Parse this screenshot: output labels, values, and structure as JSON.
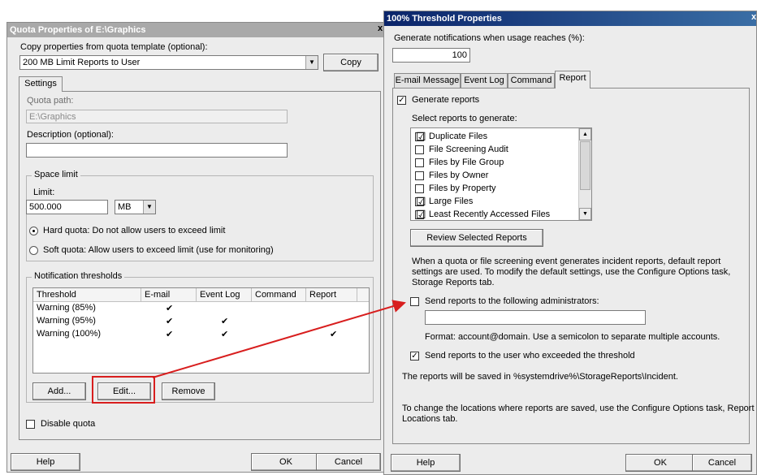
{
  "left_dialog": {
    "title": "Quota Properties of E:\\Graphics",
    "copy_label": "Copy properties from quota template (optional):",
    "template_value": "200 MB Limit Reports to User",
    "copy_button": "Copy",
    "settings_tab": "Settings",
    "quota_path_label": "Quota path:",
    "quota_path_value": "E:\\Graphics",
    "description_label": "Description (optional):",
    "description_value": "",
    "space_limit_title": "Space limit",
    "limit_label": "Limit:",
    "limit_value": "500.000",
    "limit_unit": "MB",
    "hard_quota_label": "Hard quota: Do not allow users to exceed limit",
    "soft_quota_label": "Soft quota: Allow users to exceed limit (use for monitoring)",
    "notification_title": "Notification thresholds",
    "table_headers": [
      "Threshold",
      "E-mail",
      "Event Log",
      "Command",
      "Report"
    ],
    "table_rows": [
      {
        "threshold": "Warning (85%)",
        "email": "✔",
        "eventlog": "",
        "command": "",
        "report": ""
      },
      {
        "threshold": "Warning (95%)",
        "email": "✔",
        "eventlog": "✔",
        "command": "",
        "report": ""
      },
      {
        "threshold": "Warning (100%)",
        "email": "✔",
        "eventlog": "✔",
        "command": "",
        "report": "✔"
      }
    ],
    "add_button": "Add...",
    "edit_button": "Edit...",
    "remove_button": "Remove",
    "disable_quota_label": "Disable quota",
    "help_button": "Help",
    "ok_button": "OK",
    "cancel_button": "Cancel"
  },
  "right_dialog": {
    "title": "100% Threshold Properties",
    "notify_label": "Generate notifications when usage reaches (%):",
    "notify_value": "100",
    "tabs": [
      "E-mail Message",
      "Event Log",
      "Command",
      "Report"
    ],
    "generate_reports_label": "Generate reports",
    "select_reports_label": "Select reports to generate:",
    "reports": [
      {
        "label": "Duplicate Files",
        "checked": "☑"
      },
      {
        "label": "File Screening Audit",
        "checked": ""
      },
      {
        "label": "Files by File Group",
        "checked": ""
      },
      {
        "label": "Files by Owner",
        "checked": ""
      },
      {
        "label": "Files by Property",
        "checked": ""
      },
      {
        "label": "Large Files",
        "checked": "☑"
      },
      {
        "label": "Least Recently Accessed Files",
        "checked": "☑"
      }
    ],
    "review_button": "Review Selected Reports",
    "info_text_1": "When a quota or file screening event generates incident reports, default report",
    "info_text_2": "settings are used. To modify the default settings, use the Configure Options task,",
    "info_text_3": "Storage Reports tab.",
    "send_admins_label": "Send reports to the following administrators:",
    "admins_value": "",
    "format_label": "Format: account@domain. Use a semicolon to separate multiple accounts.",
    "send_user_label": "Send reports to the user who exceeded the threshold",
    "saved_text": "The reports will be saved in %systemdrive%\\StorageReports\\Incident.",
    "change_text_1": "To change the locations where reports are saved, use the Configure Options task, Report",
    "change_text_2": "Locations tab.",
    "help_button": "Help",
    "ok_button": "OK",
    "cancel_button": "Cancel"
  },
  "colors": {
    "annotation": "#d81e1e",
    "title_active": "#0a246a",
    "title_inactive": "#a9a9a9"
  },
  "icons": {
    "close": "close-icon",
    "dropdown": "chevron-down-icon",
    "check": "checkmark-icon"
  }
}
